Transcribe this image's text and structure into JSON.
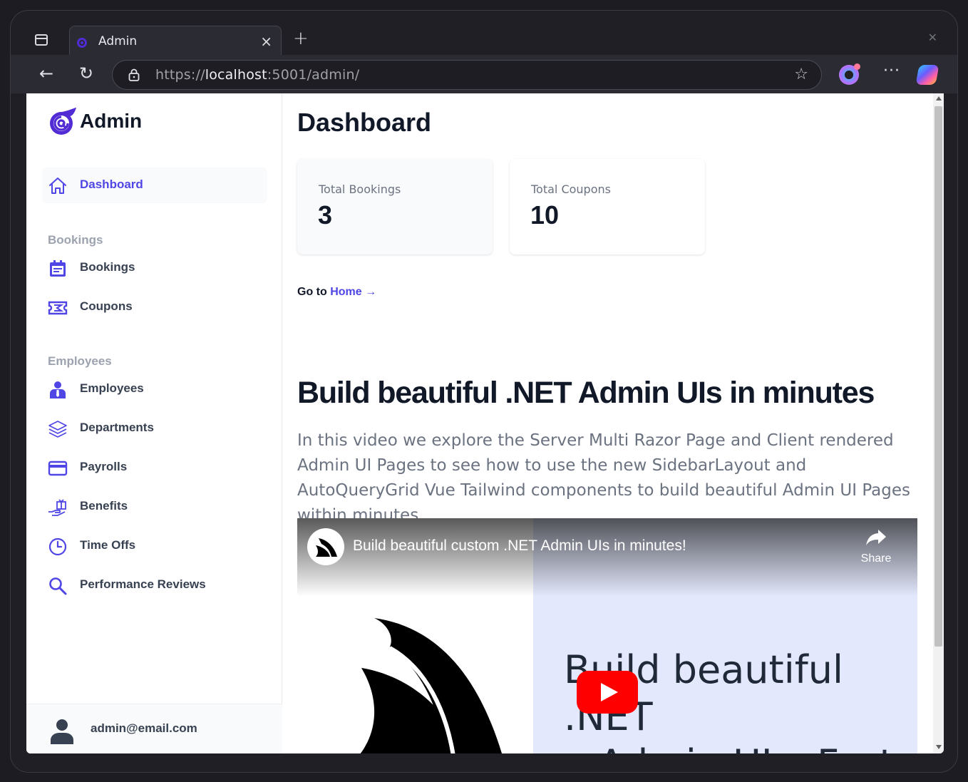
{
  "browser": {
    "tab_title": "Admin",
    "tab_close": "×",
    "new_tab": "+",
    "url_scheme": "https://",
    "url_host": "localhost",
    "url_rest": ":5001/admin/",
    "more_label": "···"
  },
  "brand": {
    "name": "Admin",
    "accent": "#4f46e5"
  },
  "sidebar": {
    "dashboard": {
      "label": "Dashboard",
      "icon": "home-icon"
    },
    "groups": [
      {
        "label": "Bookings"
      },
      {
        "label": "Employees"
      }
    ],
    "items": [
      {
        "label": "Bookings",
        "icon": "calendar-icon"
      },
      {
        "label": "Coupons",
        "icon": "ticket-icon"
      },
      {
        "label": "Employees",
        "icon": "user-tie-icon"
      },
      {
        "label": "Departments",
        "icon": "layers-icon"
      },
      {
        "label": "Payrolls",
        "icon": "credit-card-icon"
      },
      {
        "label": "Benefits",
        "icon": "gift-hand-icon"
      },
      {
        "label": "Time Offs",
        "icon": "clock-icon"
      },
      {
        "label": "Performance Reviews",
        "icon": "search-icon"
      }
    ],
    "user_email": "admin@email.com"
  },
  "main": {
    "title": "Dashboard",
    "stats": [
      {
        "label": "Total Bookings",
        "value": "3"
      },
      {
        "label": "Total Coupons",
        "value": "10"
      }
    ],
    "goto_prefix": "Go to",
    "goto_link": "Home",
    "goto_arrow": "→",
    "headline": "Build beautiful .NET Admin UIs in minutes",
    "description": "In this video we explore the Server Multi Razor Page and Client rendered Admin UI Pages to see how to use the new SidebarLayout and AutoQueryGrid Vue Tailwind components to build beautiful Admin UI Pages within minutes.",
    "video": {
      "title": "Build beautiful custom .NET Admin UIs in minutes!",
      "share_label": "Share",
      "thumb_line1": "Build beautiful .NET",
      "thumb_line2": "Admin UIs, Fast"
    }
  }
}
